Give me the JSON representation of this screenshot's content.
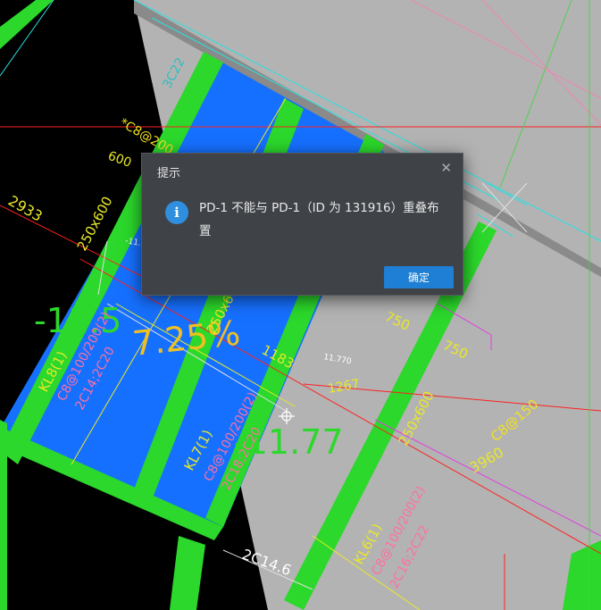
{
  "dialog": {
    "title": "提示",
    "close_symbol": "✕",
    "icon": "info-icon",
    "icon_glyph": "i",
    "message": "PD-1 不能与 PD-1（ID 为 131916）重叠布置",
    "ok_label": "确定"
  },
  "cad": {
    "elevations": [
      "-11.5",
      "-11.77"
    ],
    "slope": "7.25%",
    "dims": [
      "2933",
      "600",
      "750",
      "750",
      "1183",
      "3960",
      "1267"
    ],
    "beam_sizes": [
      "250x600",
      "250x600",
      "250x600"
    ],
    "beams": [
      {
        "name": "KL8(1)",
        "rebar": "C8@100/200(2)",
        "bars": "2C14;2C20"
      },
      {
        "name": "KL7(1)",
        "rebar": "C8@100/200(2)",
        "bars": "2C18;2C20"
      },
      {
        "name": "KL6(1)",
        "rebar": "C8@100/200(2)",
        "bars": "2C16;2C22"
      }
    ],
    "misc_labels": [
      "3C22",
      "*C8@200",
      "C8@150",
      "2C14.6",
      "11.770",
      "-11.5"
    ]
  },
  "colors": {
    "background": "#000000",
    "slab_blue": "#1670ff",
    "beam_green": "#2bd82b",
    "floor_gray": "#b3b3b3",
    "dialog_bg": "#3f4247",
    "button_blue": "#1f7fd4"
  }
}
